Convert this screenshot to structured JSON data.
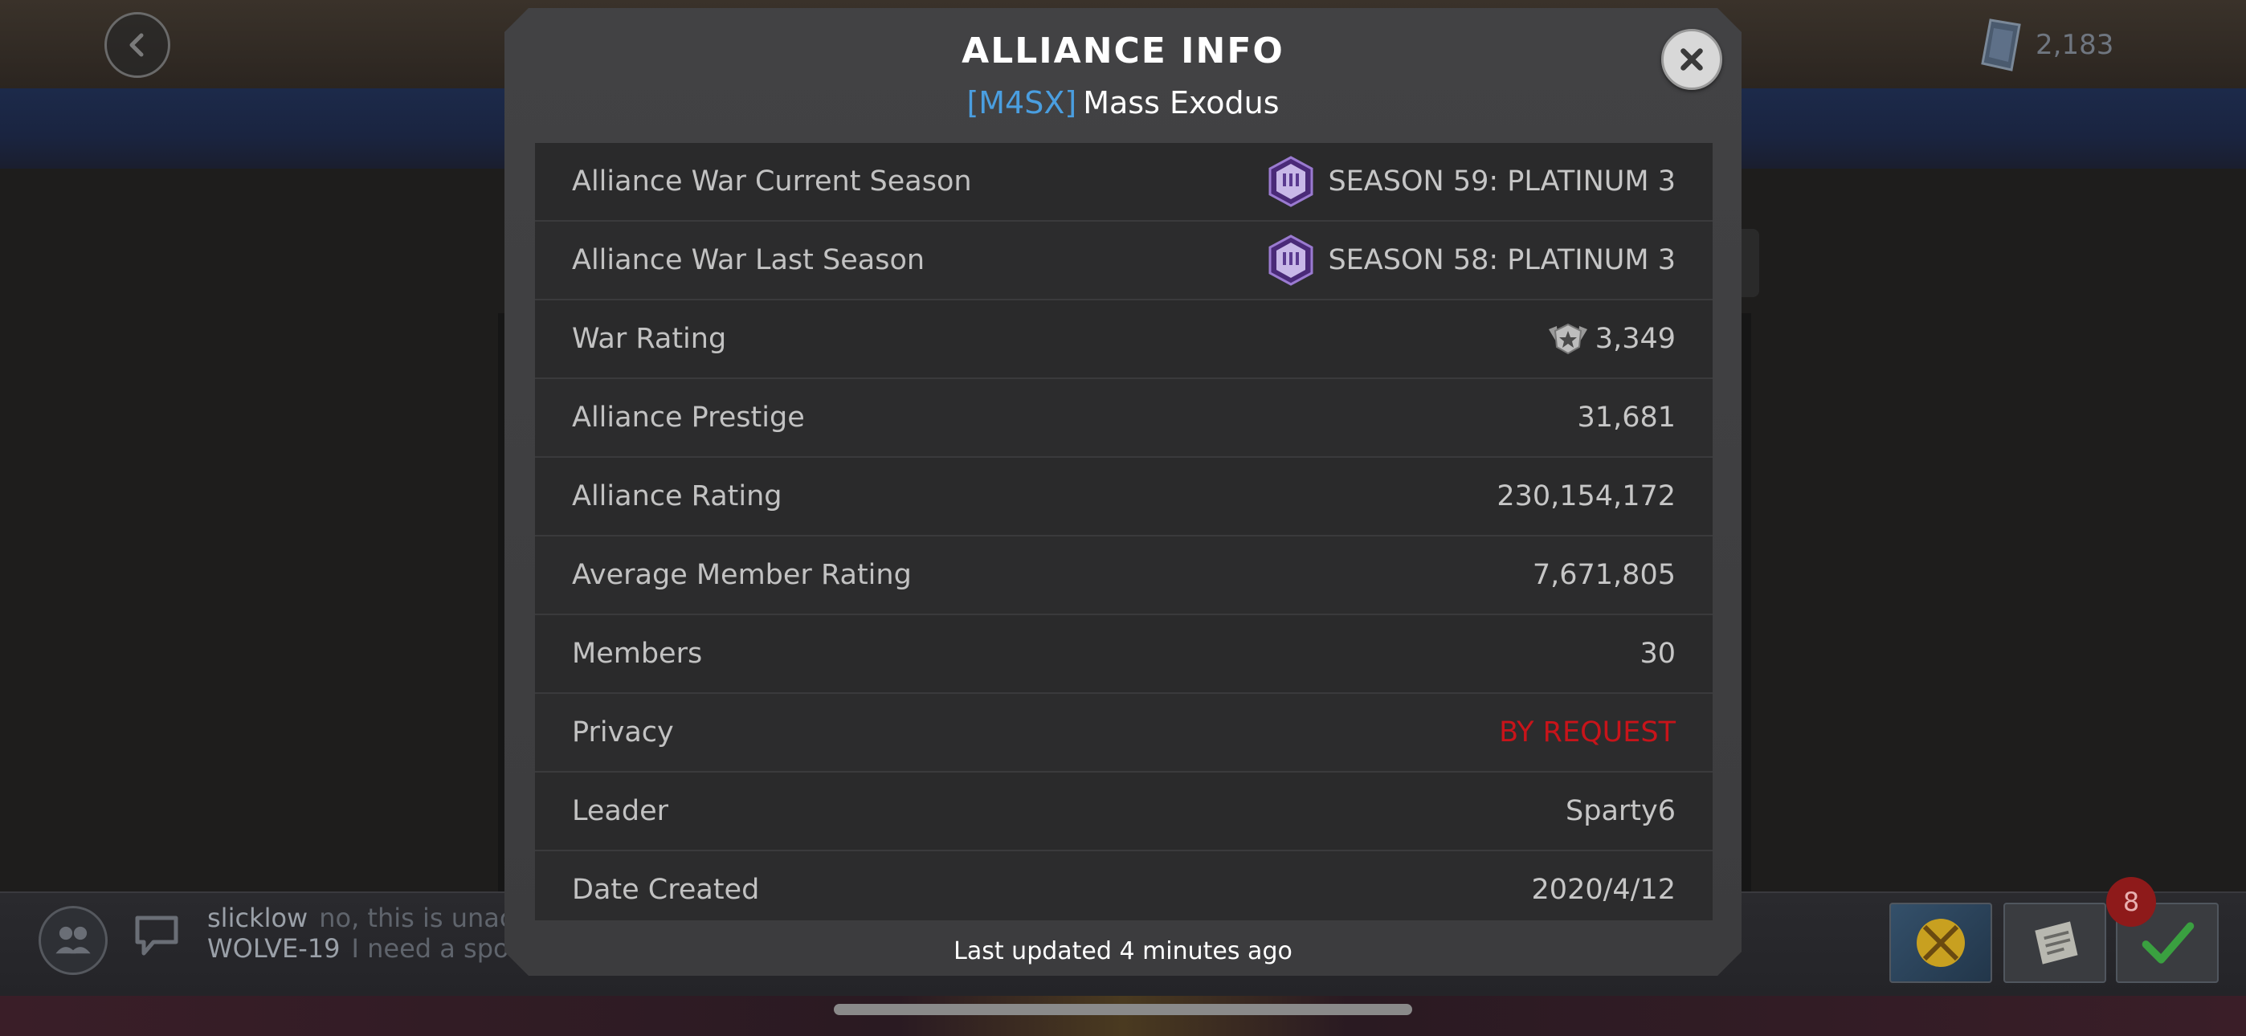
{
  "header": {
    "currency_amount": "2,183"
  },
  "modal": {
    "title": "ALLIANCE INFO",
    "alliance_tag": "[M4SX]",
    "alliance_name": "Mass Exodus",
    "rows": [
      {
        "label": "Alliance War Current Season",
        "value": "SEASON 59: PLATINUM 3",
        "icon": "platinum-season-icon"
      },
      {
        "label": "Alliance War Last Season",
        "value": "SEASON 58: PLATINUM 3",
        "icon": "platinum-season-icon"
      },
      {
        "label": "War Rating",
        "value": "3,349",
        "icon": "war-rating-icon"
      },
      {
        "label": "Alliance Prestige",
        "value": "31,681"
      },
      {
        "label": "Alliance Rating",
        "value": "230,154,172"
      },
      {
        "label": "Average Member Rating",
        "value": "7,671,805"
      },
      {
        "label": "Members",
        "value": "30"
      },
      {
        "label": "Privacy",
        "value": "BY REQUEST",
        "color": "#c8141a"
      },
      {
        "label": "Leader",
        "value": "Sparty6"
      },
      {
        "label": "Date Created",
        "value": "2020/4/12"
      }
    ],
    "footer": "Last updated 4 minutes ago"
  },
  "chat": {
    "lines": [
      {
        "name": "slicklow",
        "text": "no, this is unac"
      },
      {
        "name": "WOLVE-19",
        "text": "I need a spo"
      }
    ]
  },
  "notification_count": "8",
  "colors": {
    "accent_tag": "#4a9ee0",
    "privacy_red": "#c8141a",
    "season_purple": "#7a4ab8"
  }
}
